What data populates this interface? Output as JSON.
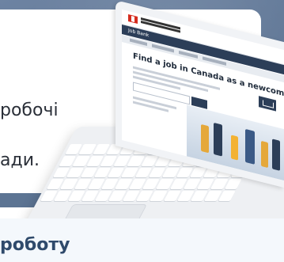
{
  "banner": {
    "text_line_1": "робочі",
    "text_line_2": "ади."
  },
  "laptop_screen": {
    "site_label": "Job Bank",
    "page_title": "Find a job in Canada as a newcomer"
  },
  "bottom": {
    "heading": "роботу"
  },
  "colors": {
    "banner": "#5e7594",
    "card": "#ffffff",
    "heading": "#2f4a6b",
    "gov_red": "#d52b1e",
    "nav_dark": "#2c3e58"
  }
}
